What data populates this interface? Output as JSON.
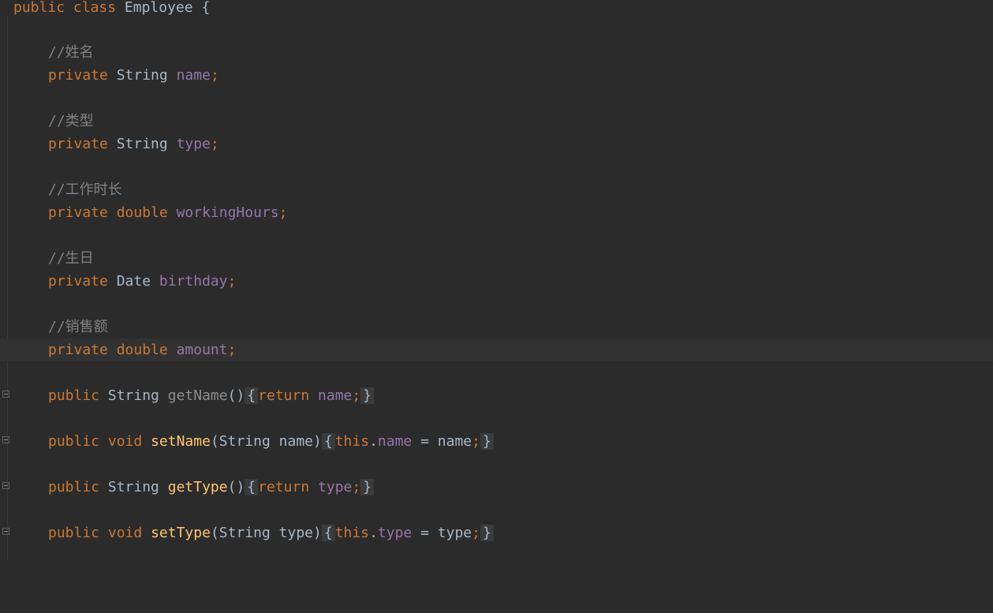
{
  "editor": {
    "class_decl": {
      "kw_public": "public",
      "kw_class": "class",
      "name": "Employee",
      "brace": "{"
    },
    "fields": [
      {
        "comment": "//姓名",
        "modifier": "private",
        "type": "String",
        "name": "name",
        "semi": ";"
      },
      {
        "comment": "//类型",
        "modifier": "private",
        "type": "String",
        "name": "type",
        "semi": ";"
      },
      {
        "comment": "//工作时长",
        "modifier": "private",
        "type": "double",
        "name": "workingHours",
        "semi": ";"
      },
      {
        "comment": "//生日",
        "modifier": "private",
        "type": "Date",
        "name": "birthday",
        "semi": ";"
      },
      {
        "comment": "//销售额",
        "modifier": "private",
        "type": "double",
        "name": "amount",
        "semi": ";"
      }
    ],
    "methods": [
      {
        "public": "public",
        "ret": "String",
        "name": "getName",
        "params": "()",
        "open": "{",
        "kw_return": "return",
        "field": "name",
        "semi": ";",
        "close": "}"
      },
      {
        "public": "public",
        "ret": "void",
        "name": "setName",
        "lparen": "(",
        "ptype": "String",
        "pname": "name",
        "rparen": ")",
        "open": "{",
        "kw_this": "this",
        "dot": ".",
        "field": "name",
        "eq": " = ",
        "value": "name",
        "semi": ";",
        "close": "}"
      },
      {
        "public": "public",
        "ret": "String",
        "name": "getType",
        "params": "()",
        "open": "{",
        "kw_return": "return",
        "field": "type",
        "semi": ";",
        "close": "}"
      },
      {
        "public": "public",
        "ret": "void",
        "name": "setType",
        "lparen": "(",
        "ptype": "String",
        "pname": "type",
        "rparen": ")",
        "open": "{",
        "kw_this": "this",
        "dot": ".",
        "field": "type",
        "eq": " = ",
        "value": "type",
        "semi": ";",
        "close": "}"
      }
    ],
    "colors": {
      "background": "#2b2b2b",
      "current_line": "#323232",
      "keyword": "#cc7832",
      "field": "#9876aa",
      "method": "#ffc66d",
      "comment": "#808080",
      "plain": "#a9b7c6"
    }
  }
}
